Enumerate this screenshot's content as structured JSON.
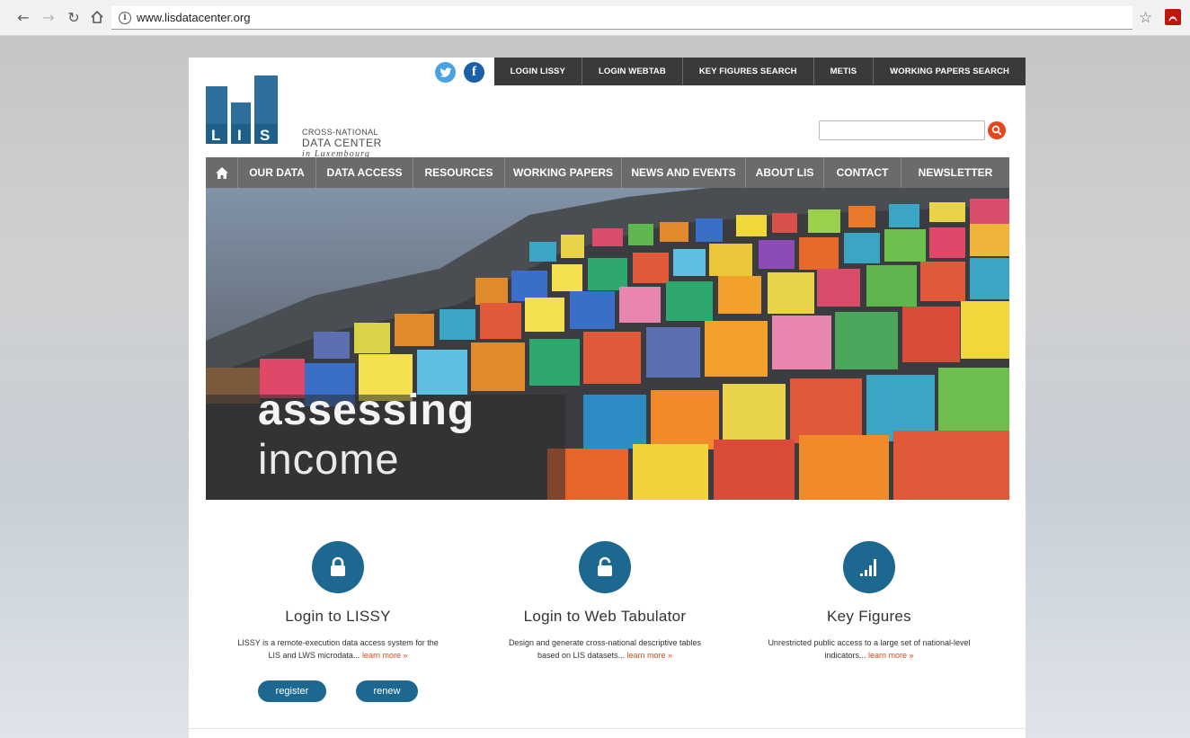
{
  "browser": {
    "url": "www.lisdatacenter.org"
  },
  "top_links": [
    "LOGIN LISSY",
    "LOGIN WEBTAB",
    "KEY FIGURES SEARCH",
    "METIS",
    "WORKING PAPERS SEARCH"
  ],
  "social": {
    "facebook_glyph": "f"
  },
  "logo": {
    "letters": [
      "L",
      "I",
      "S"
    ],
    "line1": "CROSS-NATIONAL",
    "line2": "DATA CENTER",
    "line3": "in Luxembourg"
  },
  "search": {
    "value": "",
    "placeholder": ""
  },
  "nav": {
    "items": [
      "OUR DATA",
      "DATA ACCESS",
      "RESOURCES",
      "WORKING PAPERS",
      "NEWS AND EVENTS",
      "ABOUT LIS",
      "CONTACT",
      "NEWSLETTER"
    ]
  },
  "hero": {
    "line1": "assessing",
    "line2": "income"
  },
  "features": [
    {
      "title": "Login to LISSY",
      "desc_line1": "LISSY is a remote-execution data access system for the",
      "desc_line2": "LIS and LWS microdata...",
      "learn_more": "learn more »",
      "icon": "lock-icon"
    },
    {
      "title": "Login to Web Tabulator",
      "desc_line1": "Design and generate cross-national descriptive tables",
      "desc_line2": "based on LIS datasets...",
      "learn_more": "learn more »",
      "icon": "unlock-icon"
    },
    {
      "title": "Key Figures",
      "desc_line1": "Unrestricted public access to a large set of national-level",
      "desc_line2": "indicators...",
      "learn_more": "learn more »",
      "icon": "bar-chart-icon"
    }
  ],
  "buttons": {
    "register": "register",
    "renew": "renew"
  },
  "colors": {
    "brand_blue": "#1c6891",
    "accent_orange": "#d74a1b",
    "nav_gray": "#6b6b6b",
    "top_bar": "#3a3a3a"
  }
}
